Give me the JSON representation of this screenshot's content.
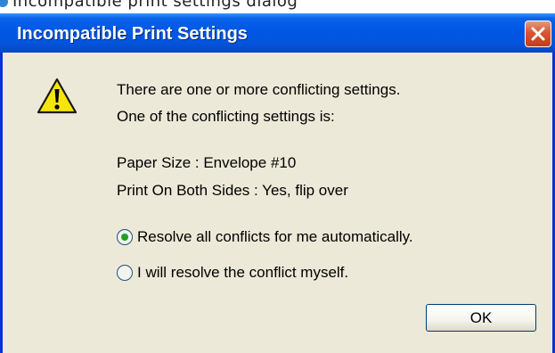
{
  "window": {
    "title": "Incompatible Print Settings"
  },
  "partial_text_above": "Incompatible print settings dialog",
  "message": {
    "line1": "There are one or more conflicting settings.",
    "line2": "One of the conflicting settings is:",
    "setting1": "Paper Size : Envelope #10",
    "setting2": "Print On Both Sides : Yes, flip over"
  },
  "options": [
    {
      "label": "Resolve all conflicts for me automatically.",
      "checked": true
    },
    {
      "label": "I will resolve the conflict myself.",
      "checked": false
    }
  ],
  "buttons": {
    "ok_label": "OK"
  },
  "icons": {
    "warning": "warning-icon",
    "close": "close-icon"
  },
  "colors": {
    "title_bar": "#0058e6",
    "dialog_bg": "#ece9d8",
    "close_button": "#d9552f",
    "warning_fill": "#f5e60a"
  }
}
